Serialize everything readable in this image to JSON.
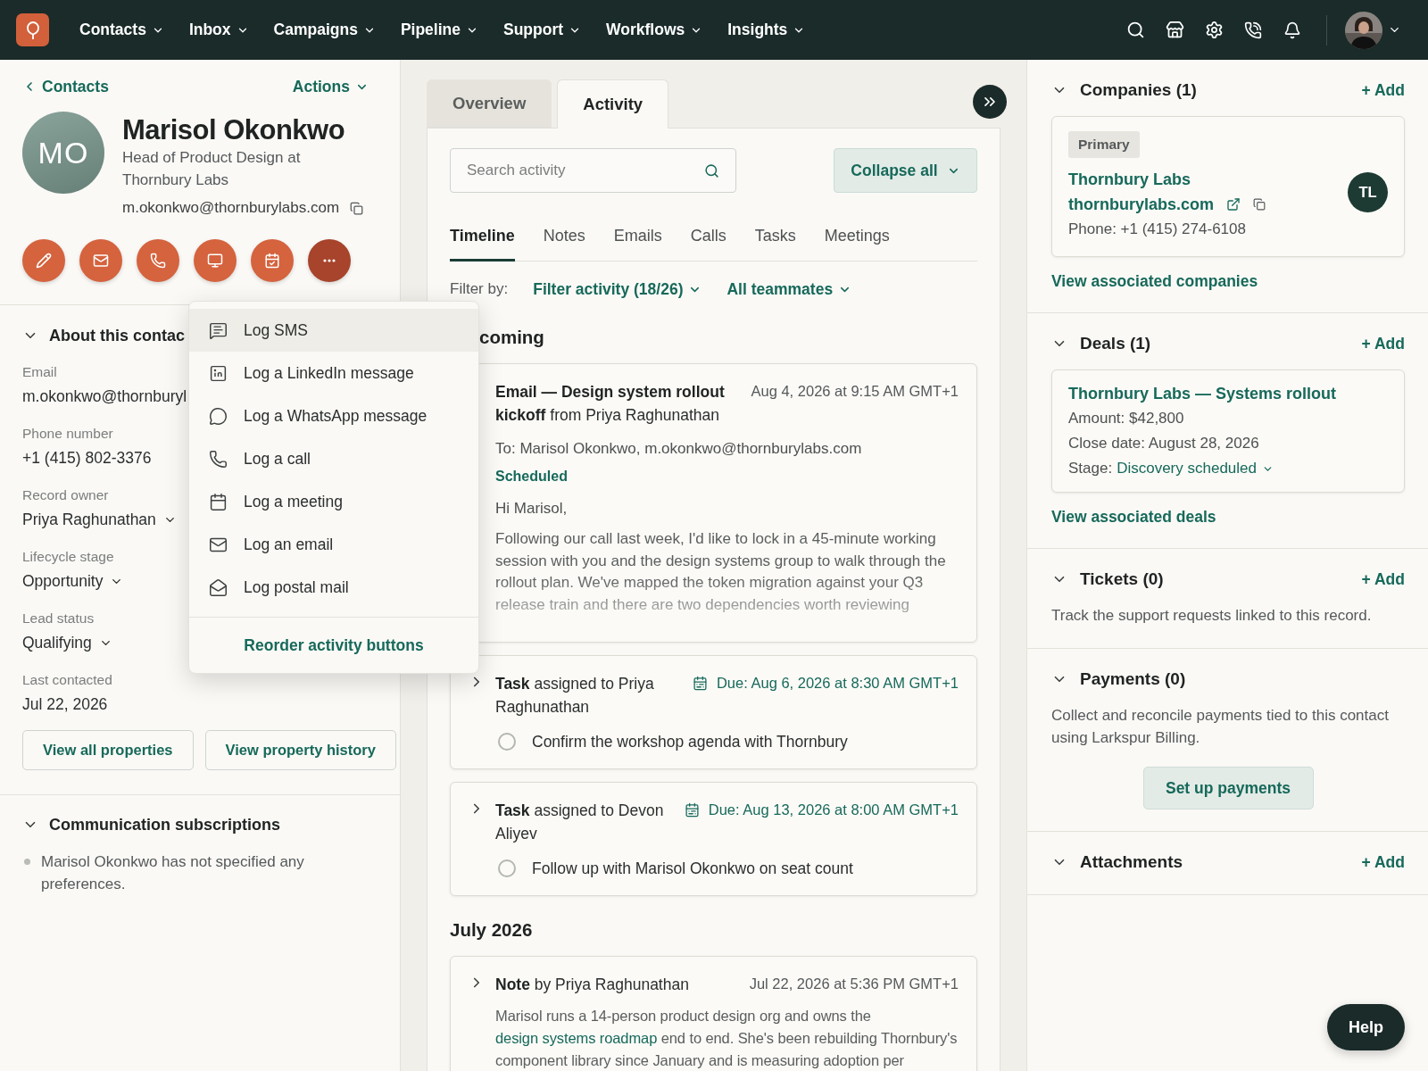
{
  "nav": {
    "items": [
      "Contacts",
      "Inbox",
      "Campaigns",
      "Pipeline",
      "Support",
      "Workflows",
      "Insights"
    ]
  },
  "contact": {
    "back": "Contacts",
    "actions": "Actions",
    "initials": "MO",
    "name": "Marisol Okonkwo",
    "title": "Head of Product Design at Thornbury Labs",
    "email": "m.okonkwo@thornburylabs.com",
    "action_buttons": [
      {
        "kind": "note",
        "selected": false
      },
      {
        "kind": "email",
        "selected": false
      },
      {
        "kind": "call",
        "selected": false
      },
      {
        "kind": "screen",
        "selected": false
      },
      {
        "kind": "meeting",
        "selected": false
      },
      {
        "kind": "more",
        "selected": true
      }
    ]
  },
  "about": {
    "heading": "About this contac",
    "expanded": true,
    "properties": [
      {
        "label": "Email",
        "value": "m.okonkwo@thornburyl",
        "kind": "text"
      },
      {
        "label": "Phone number",
        "value": "+1 (415) 802-3376",
        "kind": "text"
      },
      {
        "label": "Record owner",
        "value": "Priya Raghunathan",
        "kind": "select"
      },
      {
        "label": "Lifecycle stage",
        "value": "Opportunity",
        "kind": "select"
      },
      {
        "label": "Lead status",
        "value": "Qualifying",
        "kind": "select"
      },
      {
        "label": "Last contacted",
        "value": "Jul 22, 2026",
        "kind": "text"
      }
    ],
    "buttons": [
      "View all properties",
      "View property history"
    ]
  },
  "subscriptions": {
    "heading": "Communication subscriptions",
    "expanded": true,
    "items": [
      "Marisol Okonkwo has not specified any preferences."
    ]
  },
  "menu": {
    "items": [
      {
        "kind": "sms",
        "label": "Log SMS",
        "selected": true
      },
      {
        "kind": "linkedin",
        "label": "Log a LinkedIn message",
        "selected": false
      },
      {
        "kind": "whatsapp",
        "label": "Log a WhatsApp message",
        "selected": false
      },
      {
        "kind": "call",
        "label": "Log a call",
        "selected": false
      },
      {
        "kind": "meeting",
        "label": "Log a meeting",
        "selected": false
      },
      {
        "kind": "email",
        "label": "Log an email",
        "selected": false
      },
      {
        "kind": "postal",
        "label": "Log postal mail",
        "selected": false
      }
    ],
    "footer": "Reorder activity buttons"
  },
  "activity": {
    "tabs": [
      {
        "label": "Overview",
        "selected": false
      },
      {
        "label": "Activity",
        "selected": true
      }
    ],
    "search": {
      "placeholder": "Search activity"
    },
    "collapse": "Collapse all",
    "subtabs": [
      {
        "label": "Timeline",
        "selected": true
      },
      {
        "label": "Notes",
        "selected": false
      },
      {
        "label": "Emails",
        "selected": false
      },
      {
        "label": "Calls",
        "selected": false
      },
      {
        "label": "Tasks",
        "selected": false
      },
      {
        "label": "Meetings",
        "selected": false
      }
    ],
    "filter": {
      "label": "Filter by:",
      "options": [
        "Filter activity (18/26)",
        "All teammates"
      ]
    },
    "sections": [
      {
        "heading": "coming",
        "entries": [
          {
            "kind": "email",
            "title": "**Email — Design system rollout kickoff** from Priya Raghunathan",
            "date": "Aug 4, 2026 at 9:15 AM GMT+1",
            "to": "To: Marisol Okonkwo, m.okonkwo@thornburylabs.com",
            "status": "Scheduled",
            "greeting": "Hi Marisol,",
            "body": "Following our call last week, I'd like to lock in a 45-minute working session with you and the design systems group to walk through the rollout plan. We've mapped the token migration against your Q3 release train and there are two dependencies worth reviewing"
          },
          {
            "kind": "task",
            "expanded": false,
            "title": "**Task** assigned to Priya Raghunathan",
            "due": "Due: Aug 6, 2026 at 8:30 AM GMT+1",
            "task": "Confirm the workshop agenda with Thornbury",
            "done": false
          },
          {
            "kind": "task",
            "expanded": false,
            "title": "**Task** assigned to Devon Aliyev",
            "due": "Due: Aug 13, 2026 at 8:00 AM GMT+1",
            "task": "Follow up with Marisol Okonkwo on seat count",
            "done": false
          }
        ]
      },
      {
        "heading": "July 2026",
        "entries": [
          {
            "kind": "note",
            "expanded": false,
            "title": "**Note** by Priya Raghunathan",
            "date": "Jul 22, 2026 at 5:36 PM GMT+1",
            "body": [
              {
                "text": "Marisol runs a 14-person product design org and owns the "
              },
              {
                "text": "design systems roadmap",
                "link": true
              },
              {
                "text": " end to end. She's been rebuilding Thornbury's component library since January and is measuring adoption per"
              }
            ]
          }
        ]
      }
    ]
  },
  "sidebar": {
    "sections": [
      {
        "kind": "companies",
        "heading": "Companies (1)",
        "expanded": true,
        "add": "+ Add",
        "card": {
          "badge": "Primary",
          "name": "Thornbury Labs",
          "domain": "thornburylabs.com",
          "phone": "Phone: +1 (415) 274-6108",
          "initials": "TL"
        },
        "link": "View associated companies"
      },
      {
        "kind": "deals",
        "heading": "Deals (1)",
        "expanded": true,
        "add": "+ Add",
        "card": {
          "name": "Thornbury Labs — Systems rollout",
          "lines": [
            "Amount: $42,800",
            "Close date: August 28, 2026"
          ],
          "stage_label": "Stage:",
          "stage": "Discovery scheduled"
        },
        "link": "View associated deals"
      },
      {
        "kind": "tickets",
        "heading": "Tickets (0)",
        "expanded": true,
        "add": "+ Add",
        "text": "Track the support requests linked to this record."
      },
      {
        "kind": "payments",
        "heading": "Payments (0)",
        "expanded": true,
        "text": "Collect and reconcile payments tied to this contact using Larkspur Billing.",
        "button": "Set up payments"
      },
      {
        "kind": "attachments",
        "heading": "Attachments",
        "expanded": true,
        "add": "+ Add"
      }
    ]
  },
  "help": "Help"
}
